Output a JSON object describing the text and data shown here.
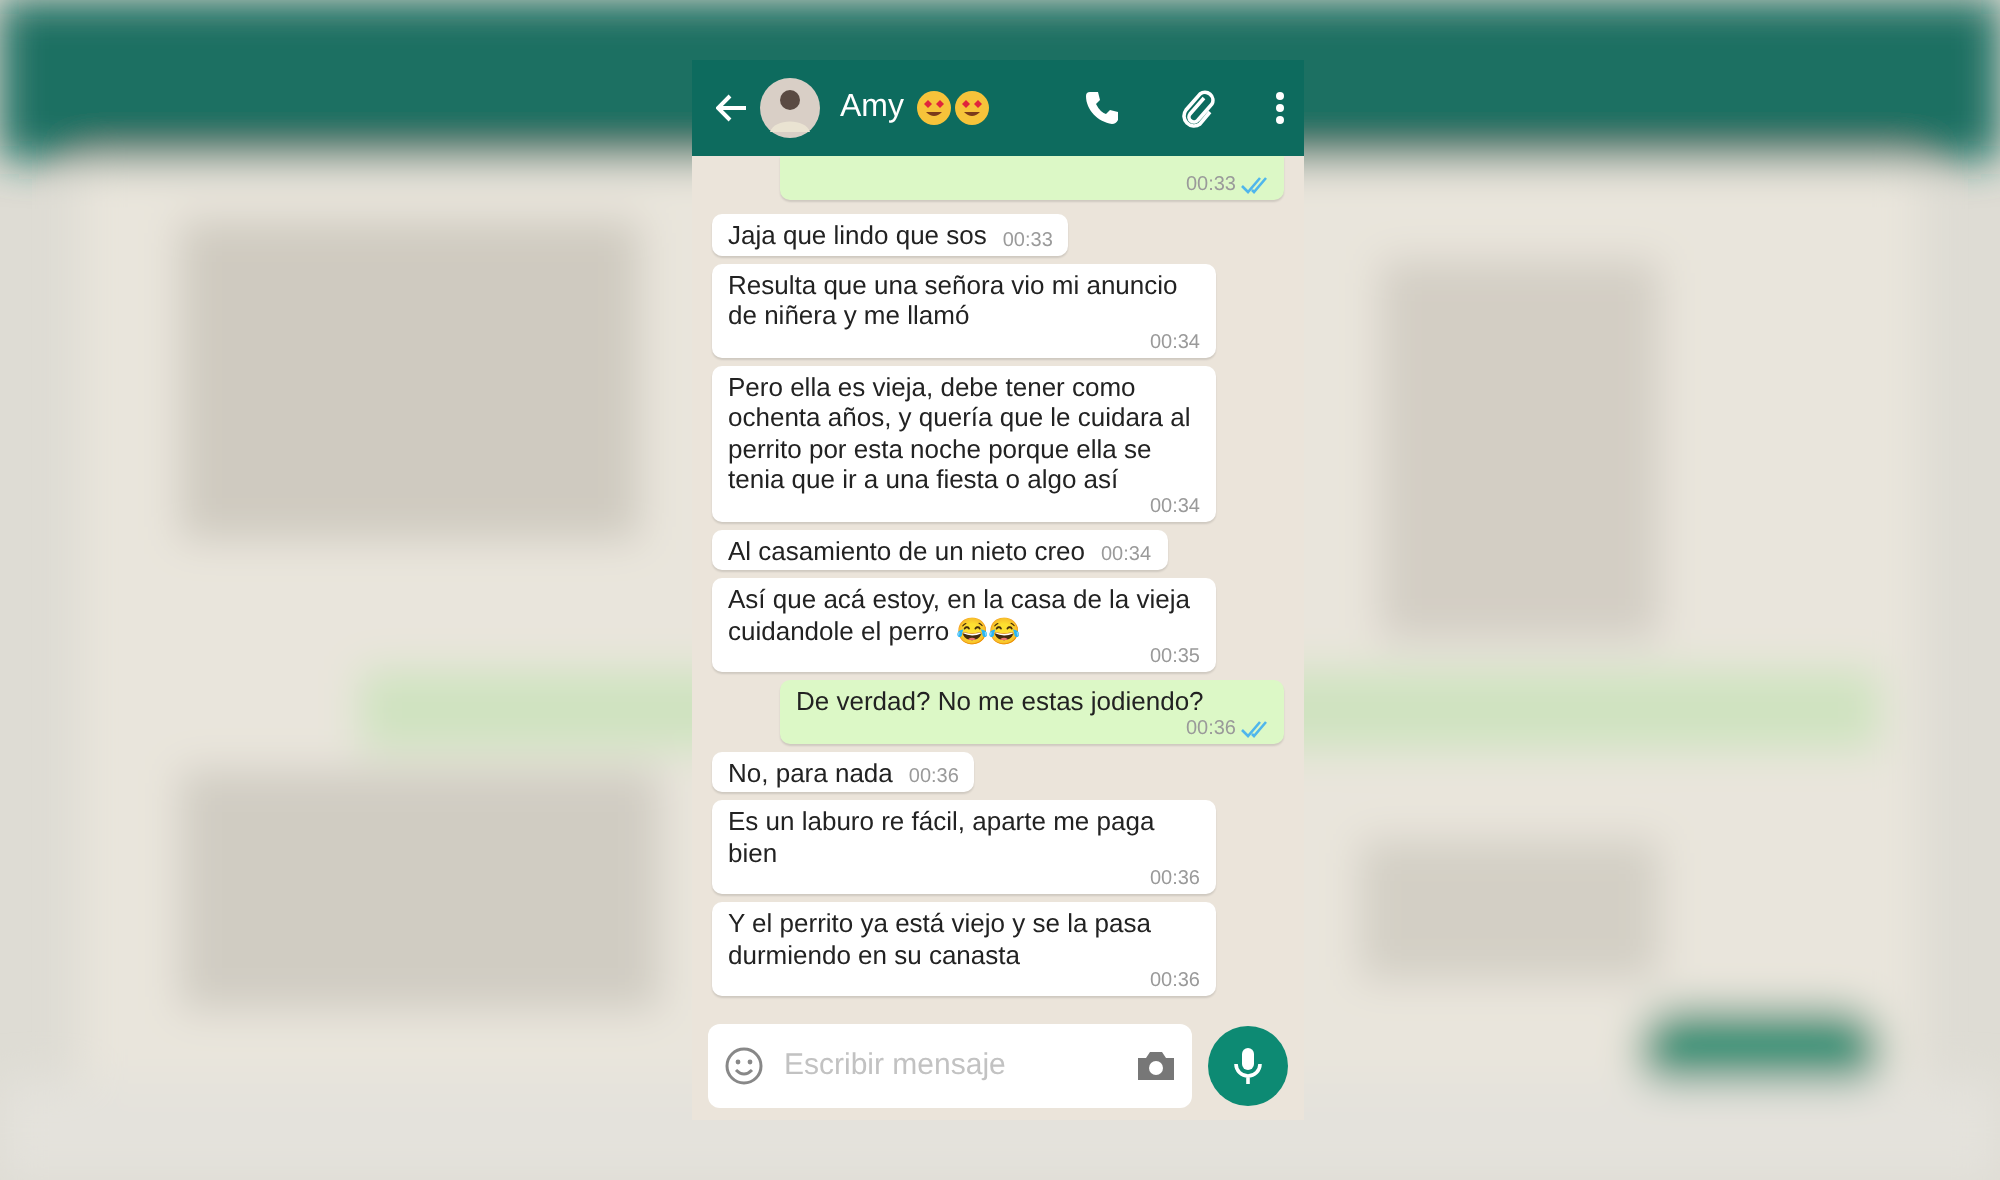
{
  "header": {
    "contact": "Amy"
  },
  "messages": [
    {
      "kind": "out",
      "time": "00:33",
      "read": true
    },
    {
      "kind": "in",
      "text": "Jaja que lindo que sos",
      "time": "00:33"
    },
    {
      "kind": "in",
      "text": "Resulta que una señora vio mi anuncio de niñera y me llamó",
      "time": "00:34"
    },
    {
      "kind": "in",
      "text": "Pero ella es vieja, debe tener como ochenta años, y quería que le cuidara al perrito por esta noche porque ella se tenia que ir a una fiesta o algo así",
      "time": "00:34"
    },
    {
      "kind": "in",
      "text": "Al casamiento de un nieto creo",
      "time": "00:34"
    },
    {
      "kind": "in",
      "text": "Así que acá estoy, en la casa de la vieja cuidandole el perro 😂😂",
      "time": "00:35"
    },
    {
      "kind": "out",
      "text": "De verdad? No me estas jodiendo?",
      "time": "00:36",
      "read": true
    },
    {
      "kind": "in",
      "text": "No, para nada",
      "time": "00:36"
    },
    {
      "kind": "in",
      "text": "Es un laburo re fácil, aparte me paga bien",
      "time": "00:36"
    },
    {
      "kind": "in",
      "text": "Y el perrito ya está viejo y se la pasa durmiendo en su canasta",
      "time": "00:36"
    }
  ],
  "composer": {
    "placeholder": "Escribir mensaje"
  }
}
